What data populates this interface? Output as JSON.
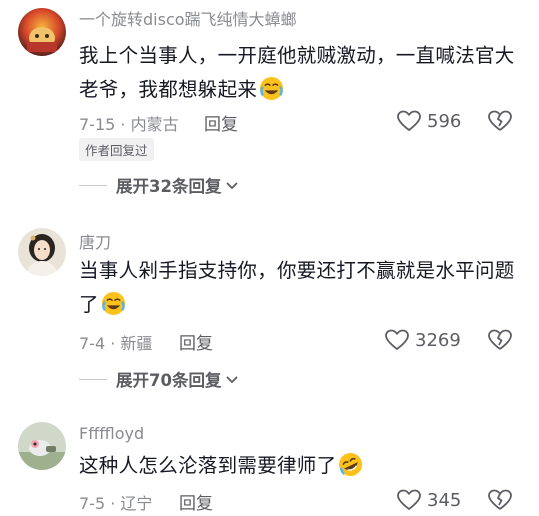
{
  "comments": [
    {
      "username": "一个旋转disco踹飞纯情大蟑螂",
      "text": "我上个当事人，一开庭他就贼激动，一直喊法官大老爷，我都想躲起来",
      "emoji": "crying-laughing-emoji",
      "date": "7-15",
      "location": "内蒙古",
      "reply_label": "回复",
      "likes": "596",
      "badge": "作者回复过",
      "expand_label": "展开32条回复"
    },
    {
      "username": "唐刀",
      "text": "当事人剁手指支持你，你要还打不赢就是水平问题了",
      "emoji": "crying-laughing-emoji",
      "date": "7-4",
      "location": "新疆",
      "reply_label": "回复",
      "likes": "3269",
      "expand_label": "展开70条回复"
    },
    {
      "username": "Fffffloyd",
      "text": "这种人怎么沦落到需要律师了",
      "emoji": "rofl-emoji",
      "date": "7-5",
      "location": "辽宁",
      "reply_label": "回复",
      "likes": "345"
    }
  ],
  "colors": {
    "text_primary": "#161823",
    "text_secondary": "#8a8b91",
    "badge_bg": "#f1f1f2"
  }
}
